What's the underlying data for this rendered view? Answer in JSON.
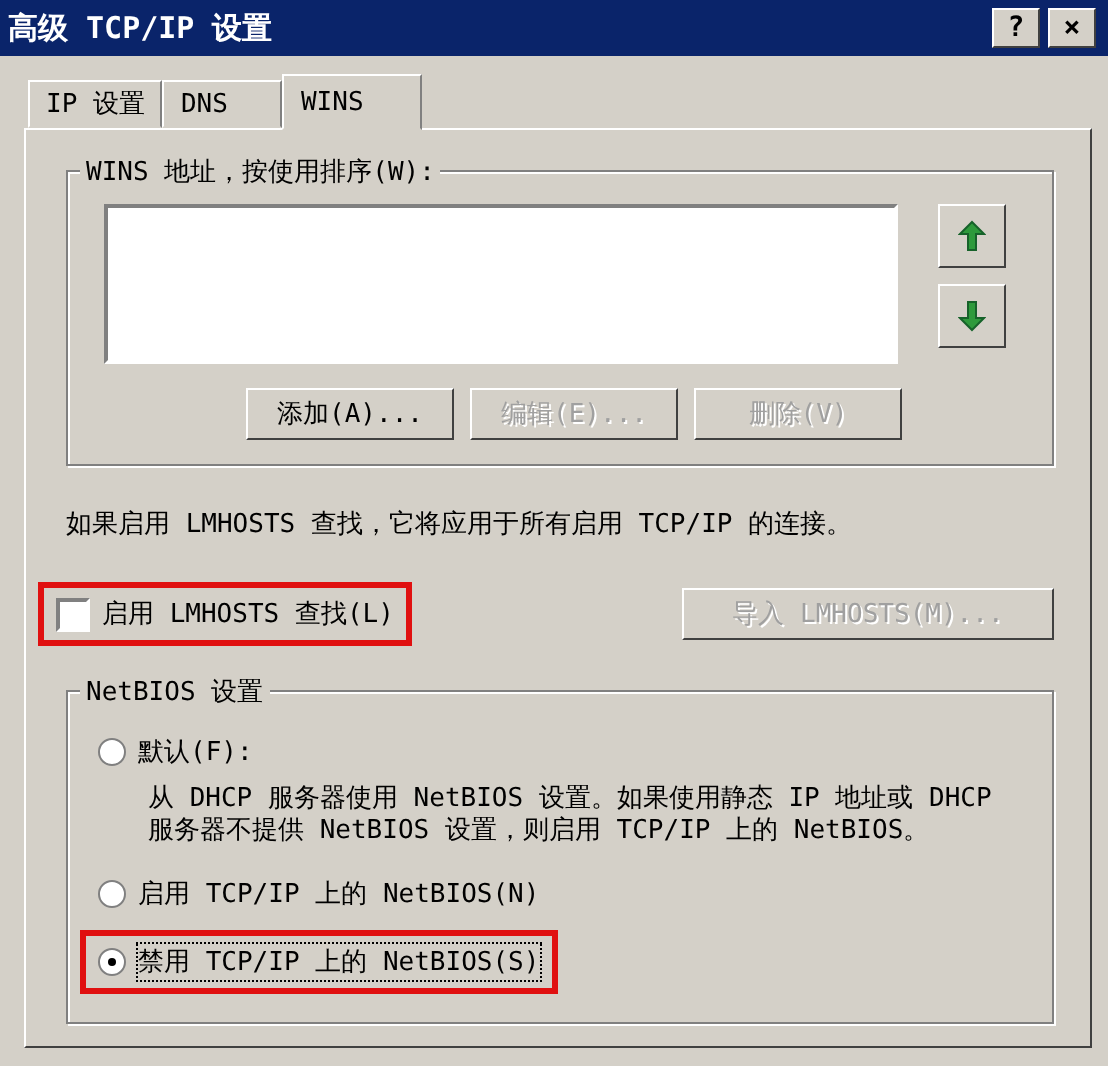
{
  "window": {
    "title": "高级 TCP/IP 设置"
  },
  "title_buttons": [
    "?",
    "×"
  ],
  "tabs": [
    {
      "label": "IP 设置",
      "selected": false
    },
    {
      "label": "DNS",
      "selected": false
    },
    {
      "label": "WINS",
      "selected": true
    }
  ],
  "wins_group": {
    "title": "WINS 地址，按使用排序(W):",
    "buttons": [
      {
        "label": "添加(A)...",
        "disabled": false
      },
      {
        "label": "编辑(E)...",
        "disabled": true
      },
      {
        "label": "删除(V)",
        "disabled": true
      }
    ]
  },
  "lmhosts_note": "如果启用 LMHOSTS 查找，它将应用于所有启用 TCP/IP 的连接。",
  "lmhosts_checkbox": {
    "label": "启用 LMHOSTS 查找(L)",
    "checked": false,
    "highlighted": true
  },
  "import_button": {
    "label": "导入 LMHOSTS(M)...",
    "disabled": true
  },
  "netbios_group": {
    "title": "NetBIOS 设置",
    "options": [
      {
        "label": "默认(F):",
        "selected": false,
        "highlighted": false,
        "description": "从 DHCP 服务器使用 NetBIOS 设置。如果使用静态 IP 地址或 DHCP 服务器不提供 NetBIOS 设置，则启用 TCP/IP 上的 NetBIOS。"
      },
      {
        "label": "启用 TCP/IP 上的 NetBIOS(N)",
        "selected": false,
        "highlighted": false
      },
      {
        "label": "禁用 TCP/IP 上的 NetBIOS(S)",
        "selected": true,
        "highlighted": true
      }
    ]
  }
}
